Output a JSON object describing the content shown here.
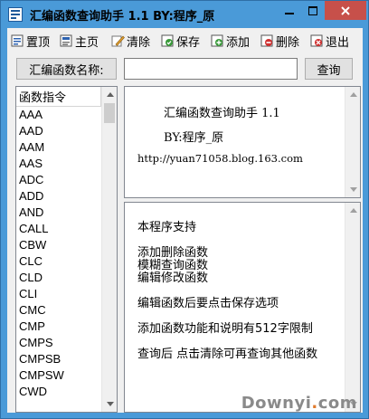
{
  "window": {
    "title": "汇编函数查询助手 1.1  BY:程序_原"
  },
  "toolbar": {
    "pin_label": "置顶",
    "home_label": "主页",
    "clear_label": "清除",
    "save_label": "保存",
    "add_label": "添加",
    "delete_label": "删除",
    "exit_label": "退出"
  },
  "search": {
    "name_label": "汇编函数名称:",
    "input_value": "",
    "button_label": "查询"
  },
  "list": {
    "header": "函数指令",
    "items": [
      "AAA",
      "AAD",
      "AAM",
      "AAS",
      "ADC",
      "ADD",
      "AND",
      "CALL",
      "CBW",
      "CLC",
      "CLD",
      "CLI",
      "CMC",
      "CMP",
      "CMPS",
      "CMPSB",
      "CMPSW",
      "CWD"
    ]
  },
  "info": {
    "title": "汇编函数查询助手 1.1",
    "author": "BY:程序_原",
    "url": "http://yuan71058.blog.163.com"
  },
  "notes": {
    "line1": "本程序支持",
    "line2": "添加删除函数",
    "line3": "模糊查询函数",
    "line4": "编辑修改函数",
    "line5": "编辑函数后要点击保存选项",
    "line6": "添加函数功能和说明有512字限制",
    "line7": "查询后 点击清除可再查询其他函数"
  },
  "watermark": {
    "text_main": "Downyi",
    "text_dot": ".",
    "text_tail": "com"
  },
  "colors": {
    "title_bar": "#4a9ad8",
    "close_button": "#c7504a",
    "client_bg": "#f0f0f0"
  }
}
